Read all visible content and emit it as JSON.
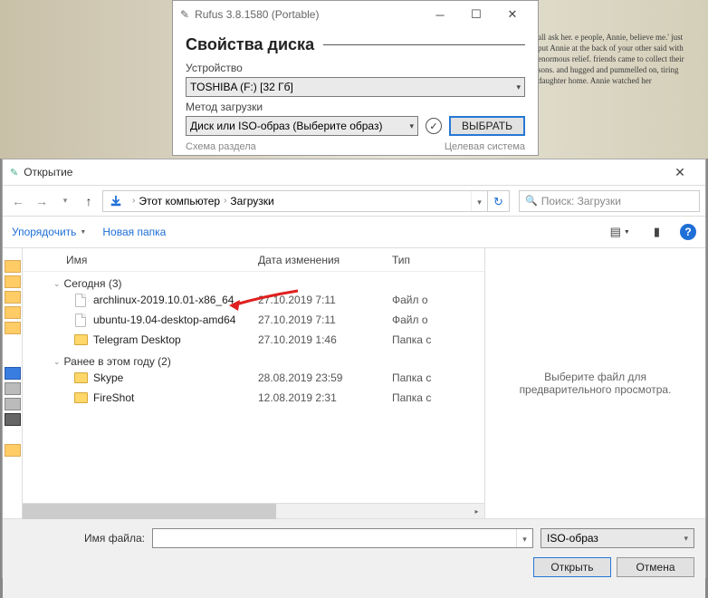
{
  "rufus": {
    "title": "Rufus 3.8.1580 (Portable)",
    "section_heading": "Свойства диска",
    "device_label": "Устройство",
    "device_value": "TOSHIBA (F:) [32 Гб]",
    "boot_label": "Метод загрузки",
    "boot_value": "Диск или ISO-образ (Выберите образ)",
    "select_btn": "ВЫБРАТЬ",
    "sub_left": "Схема раздела",
    "sub_right": "Целевая система"
  },
  "dialog": {
    "title": "Открытие",
    "breadcrumb_root": "Этот компьютер",
    "breadcrumb_folder": "Загрузки",
    "search_placeholder": "Поиск: Загрузки",
    "toolbar_organize": "Упорядочить",
    "toolbar_newfolder": "Новая папка",
    "columns": {
      "name": "Имя",
      "modified": "Дата изменения",
      "type": "Тип"
    },
    "groups": [
      {
        "label": "Сегодня (3)",
        "items": [
          {
            "name": "archlinux-2019.10.01-x86_64",
            "date": "27.10.2019 7:11",
            "type": "Файл о",
            "kind": "file"
          },
          {
            "name": "ubuntu-19.04-desktop-amd64",
            "date": "27.10.2019 7:11",
            "type": "Файл о",
            "kind": "file"
          },
          {
            "name": "Telegram Desktop",
            "date": "27.10.2019 1:46",
            "type": "Папка с",
            "kind": "folder"
          }
        ]
      },
      {
        "label": "Ранее в этом году (2)",
        "items": [
          {
            "name": "Skype",
            "date": "28.08.2019 23:59",
            "type": "Папка с",
            "kind": "folder"
          },
          {
            "name": "FireShot",
            "date": "12.08.2019 2:31",
            "type": "Папка с",
            "kind": "folder"
          }
        ]
      }
    ],
    "preview_text": "Выберите файл для предварительного просмотра.",
    "filename_label": "Имя файла:",
    "filename_value": "",
    "filter_value": "ISO-образ",
    "open_btn": "Открыть",
    "cancel_btn": "Отмена"
  },
  "bg_text": "all ask her.\ne people, Annie, believe me.'\njust put Annie at the back of your\n\nother said with enormous relief.\nfriends came to collect their sons.\nand hugged and pummelled on, tiring\ndaughter home. Annie watched her"
}
